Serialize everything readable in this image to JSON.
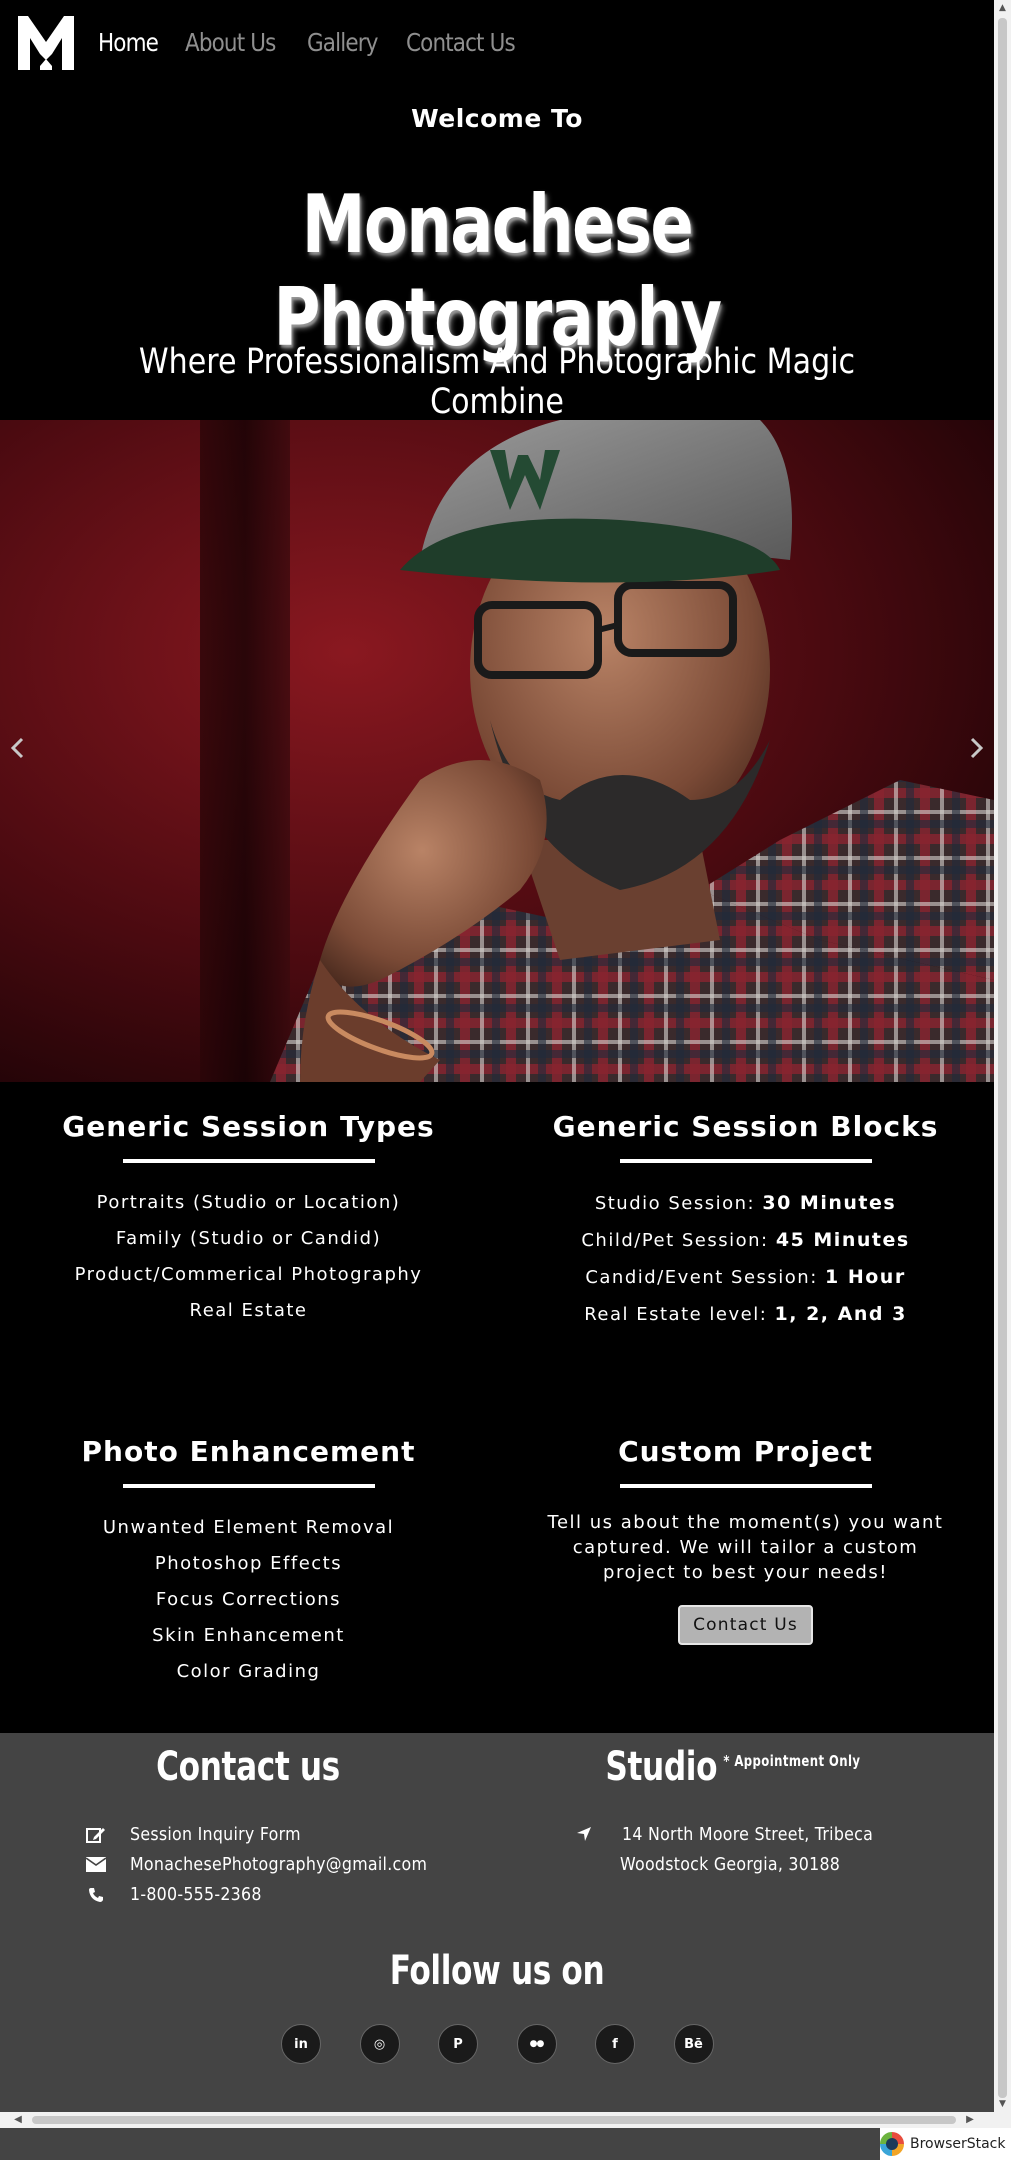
{
  "nav": {
    "items": [
      {
        "label": "Home",
        "active": true
      },
      {
        "label": "About Us",
        "active": false
      },
      {
        "label": "Gallery",
        "active": false
      },
      {
        "label": "Contact Us",
        "active": false
      }
    ]
  },
  "hero": {
    "welcome": "Welcome To",
    "title": "Monachese Photography",
    "tagline": "Where Professionalism And Photographic Magic Combine"
  },
  "carousel": {
    "prev_icon": "chevron-left-icon",
    "next_icon": "chevron-right-icon"
  },
  "services": {
    "session_types": {
      "title": "Generic Session Types",
      "items": [
        "Portraits (Studio or Location)",
        "Family (Studio or Candid)",
        "Product/Commerical Photography",
        "Real Estate"
      ]
    },
    "session_blocks": {
      "title": "Generic Session Blocks",
      "items": [
        {
          "label": "Studio Session: ",
          "value": "30 Minutes"
        },
        {
          "label": "Child/Pet Session: ",
          "value": "45 Minutes"
        },
        {
          "label": "Candid/Event Session: ",
          "value": "1 Hour"
        },
        {
          "label": "Real Estate level: ",
          "value": "1, 2, And 3"
        }
      ]
    },
    "enhancement": {
      "title": "Photo Enhancement",
      "items": [
        "Unwanted Element Removal",
        "Photoshop Effects",
        "Focus Corrections",
        "Skin Enhancement",
        "Color Grading"
      ]
    },
    "custom": {
      "title": "Custom Project",
      "text": "Tell us about the moment(s) you want captured. We will tailor a custom project to best your needs!",
      "button": "Contact Us"
    }
  },
  "footer": {
    "contact_heading": "Contact us",
    "studio_heading": "Studio",
    "studio_sub": "* Appointment Only",
    "contact_items": [
      {
        "icon": "edit-icon",
        "text": "Session Inquiry Form"
      },
      {
        "icon": "envelope-icon",
        "text": "MonachesePhotography@gmail.com"
      },
      {
        "icon": "phone-icon",
        "text": "1-800-555-2368"
      }
    ],
    "address": {
      "icon": "location-arrow-icon",
      "line1": "14 North Moore Street, Tribeca",
      "line2": "Woodstock Georgia, 30188"
    },
    "follow_heading": "Follow us on",
    "social": [
      {
        "name": "linkedin-icon",
        "label": "in"
      },
      {
        "name": "instagram-icon",
        "label": "◎"
      },
      {
        "name": "pinterest-icon",
        "label": "P"
      },
      {
        "name": "flickr-icon",
        "label": "●●"
      },
      {
        "name": "facebook-icon",
        "label": "f"
      },
      {
        "name": "behance-icon",
        "label": "Bē"
      }
    ]
  },
  "browser": {
    "badge": "BrowserStack"
  }
}
